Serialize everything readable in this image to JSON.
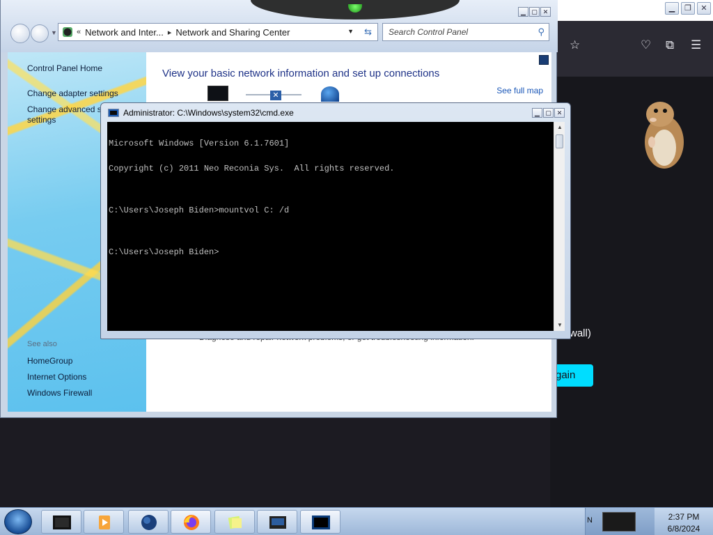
{
  "control_panel": {
    "breadcrumb": [
      "Network and Inter...",
      "Network and Sharing Center"
    ],
    "search_placeholder": "Search Control Panel",
    "left_links": [
      "Control Panel Home",
      "Change adapter settings",
      "Change advanced sharing",
      "settings"
    ],
    "see_also_label": "See also",
    "see_also_links": [
      "HomeGroup",
      "Internet Options",
      "Windows Firewall"
    ],
    "heading": "View your basic network information and set up connections",
    "see_full_map": "See full map",
    "diagnose_text": "Diagnose and repair network problems, or get troubleshooting information."
  },
  "cmd": {
    "title": "Administrator: C:\\Windows\\system32\\cmd.exe",
    "lines": [
      "Microsoft Windows [Version 6.1.7601]",
      "Copyright (c) 2011 Neo Reconia Sys.  All rights reserved.",
      "",
      "C:\\Users\\Joseph Biden>mountvol C: /d",
      "",
      "C:\\Users\\Joseph Biden>"
    ]
  },
  "browser": {
    "partial_text": "wall)",
    "button_partial": "gain",
    "accent": "#00ddff"
  },
  "taskbar": {
    "tray_lang": "N",
    "time": "2:37 PM",
    "date": "6/8/2024"
  },
  "icons": {
    "window_controls": [
      "minimize-icon",
      "maximize-icon",
      "close-icon"
    ],
    "toolbar": [
      "star-icon",
      "pocket-icon",
      "extensions-icon",
      "menu-icon"
    ]
  }
}
